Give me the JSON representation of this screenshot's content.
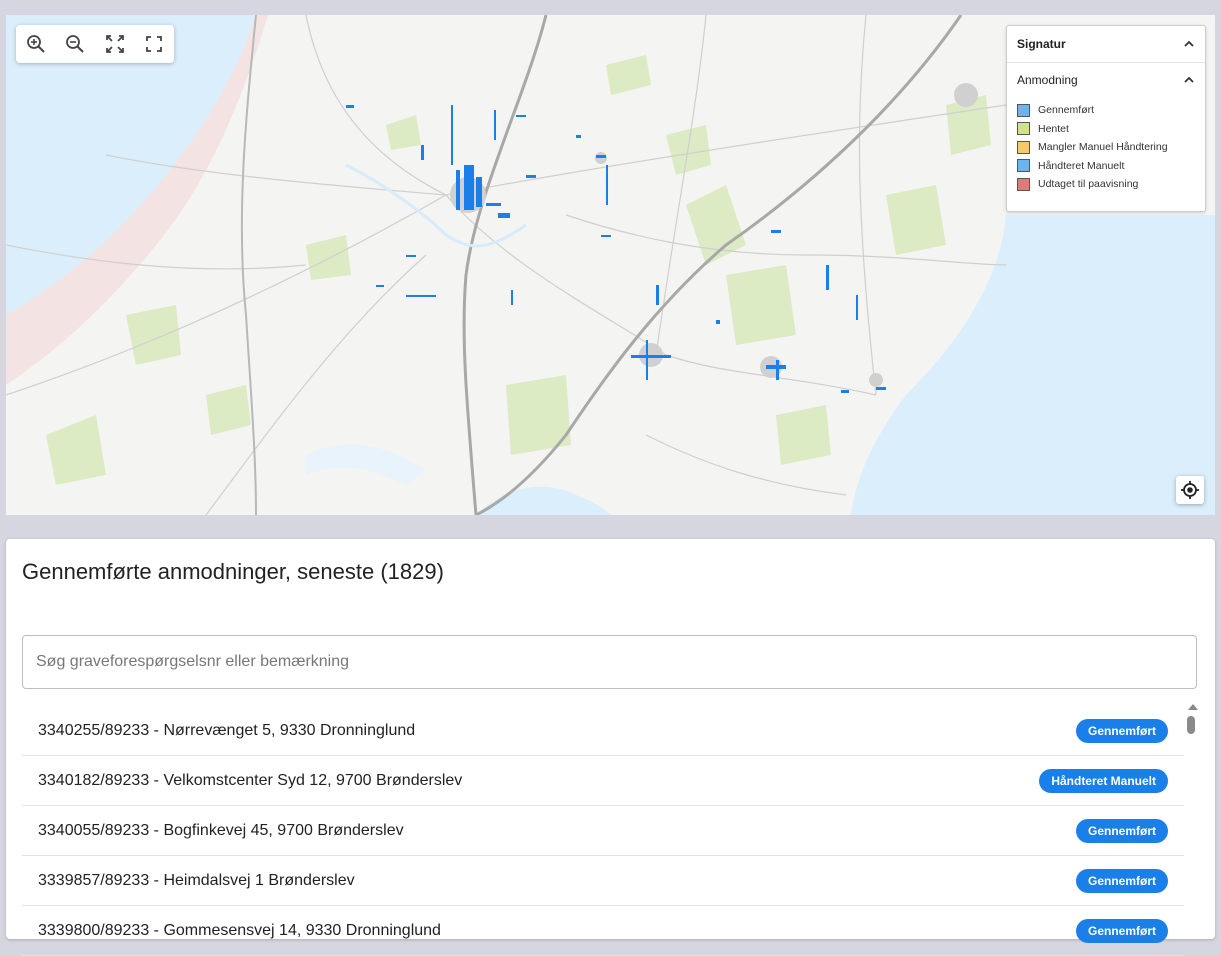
{
  "map": {
    "toolbar": {
      "zoom_in_icon": "zoom-in-icon",
      "zoom_out_icon": "zoom-out-icon",
      "fit_icon": "fit-bounds-icon",
      "fullscreen_icon": "fullscreen-icon"
    },
    "locate_icon": "my-location-icon",
    "legend": {
      "title": "Signatur",
      "group": "Anmodning",
      "items": [
        {
          "label": "Gennemført",
          "color": "#6fb2ec"
        },
        {
          "label": "Hentet",
          "color": "#cfe48a"
        },
        {
          "label": "Mangler Manuel Håndtering",
          "color": "#f6c96e"
        },
        {
          "label": "Håndteret Manuelt",
          "color": "#6fb2ec"
        },
        {
          "label": "Udtaget til paavisning",
          "color": "#e07a7a"
        }
      ]
    },
    "colors": {
      "water": "#dbeefb",
      "land": "#f4f4f2",
      "green": "#dcebc4",
      "road": "#c9c9c9",
      "coverage": "#1a7fe8"
    }
  },
  "list_panel": {
    "title": "Gennemførte anmodninger, seneste (1829)",
    "search": {
      "placeholder": "Søg graveforespørgselsnr eller bemærkning",
      "value": ""
    },
    "rows": [
      {
        "text": "3340255/89233 - Nørrevænget 5, 9330 Dronninglund",
        "status": "Gennemført"
      },
      {
        "text": "3340182/89233 - Velkomstcenter Syd 12, 9700 Brønderslev",
        "status": "Håndteret Manuelt"
      },
      {
        "text": "3340055/89233 - Bogfinkevej 45, 9700 Brønderslev",
        "status": "Gennemført"
      },
      {
        "text": "3339857/89233 - Heimdalsvej 1 Brønderslev",
        "status": "Gennemført"
      },
      {
        "text": "3339800/89233 - Gommesensvej 14, 9330 Dronninglund",
        "status": "Gennemført"
      }
    ],
    "status_color": "#1a7fe8"
  }
}
